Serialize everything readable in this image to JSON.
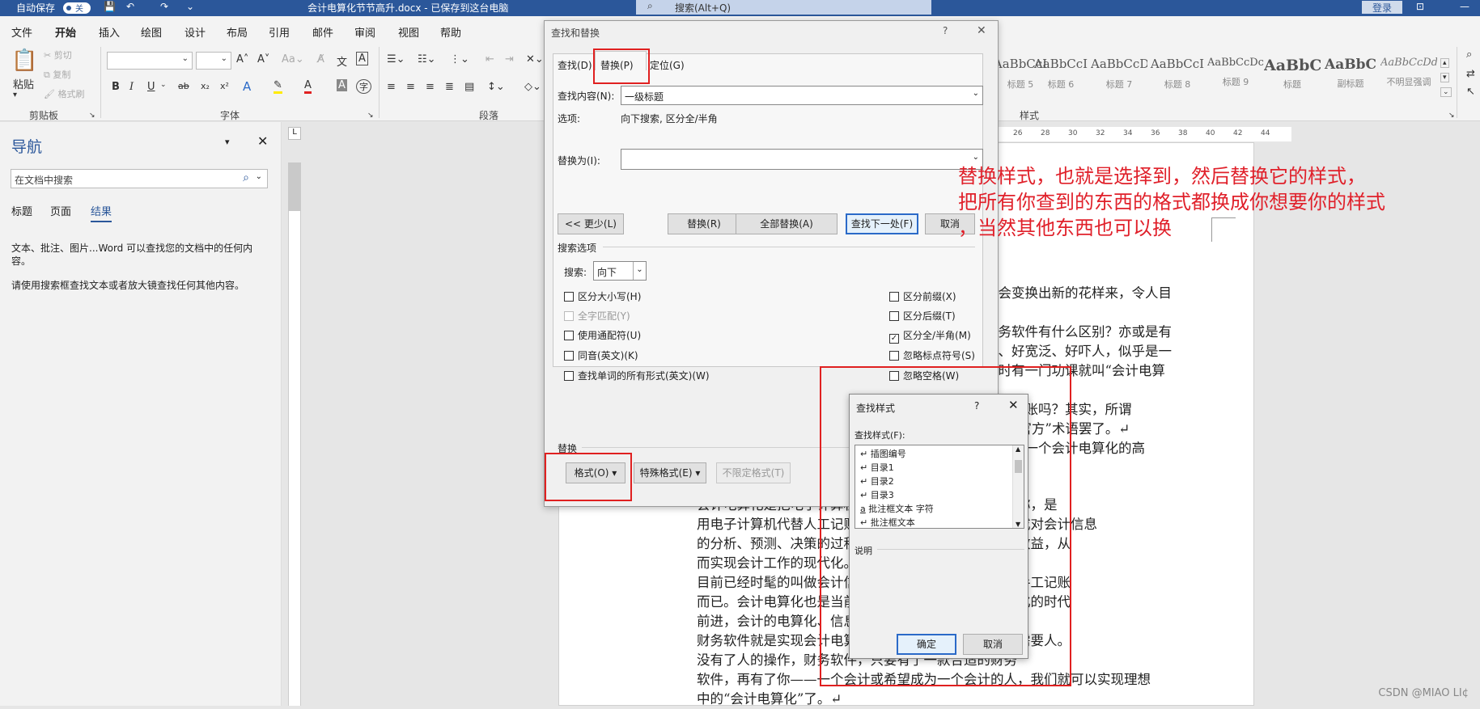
{
  "titlebar": {
    "autosave_label": "自动保存",
    "autosave_state": "关",
    "doc_title": "会计电算化节节高升.docx - 已保存到这台电脑",
    "search_placeholder": "搜索(Alt+Q)",
    "login_label": "登录"
  },
  "menu": [
    "文件",
    "开始",
    "插入",
    "绘图",
    "设计",
    "布局",
    "引用",
    "邮件",
    "审阅",
    "视图",
    "帮助"
  ],
  "menu_active": "开始",
  "ribbon": {
    "clipboard": {
      "paste": "粘贴",
      "cut": "剪切",
      "copy": "复制",
      "painter": "格式刷",
      "group": "剪贴板"
    },
    "font_group": "字体",
    "paragraph_group": "段落",
    "styles_group": "样式",
    "styles": [
      {
        "preview": "AaBbCcI",
        "name": "标题 5"
      },
      {
        "preview": "AaBbCcI",
        "name": "标题 6"
      },
      {
        "preview": "AaBbCcD",
        "name": "标题 7"
      },
      {
        "preview": "AaBbCcI",
        "name": "标题 8"
      },
      {
        "preview": "AaBbCcDc",
        "name": "标题 9"
      },
      {
        "preview": "AaBbC",
        "name": "标题"
      },
      {
        "preview": "AaBbC",
        "name": "副标题"
      },
      {
        "preview": "AaBbCcDd",
        "name": "不明显强调"
      }
    ]
  },
  "nav": {
    "title": "导航",
    "search_placeholder": "在文档中搜索",
    "tabs": [
      "标题",
      "页面",
      "结果"
    ],
    "active_tab": "结果",
    "msg1": "文本、批注、图片...Word 可以查找您的文档中的任何内容。",
    "msg2": "请使用搜索框查找文本或者放大镜查找任何其他内容。"
  },
  "ruler_ticks": [
    "26",
    "28",
    "30",
    "32",
    "34",
    "36",
    "38",
    "40",
    "42",
    "44"
  ],
  "find_replace": {
    "title": "查找和替换",
    "help": "?",
    "tabs": [
      "查找(D)",
      "替换(P)",
      "定位(G)"
    ],
    "active_tab": "替换(P)",
    "find_label": "查找内容(N):",
    "find_value": "一级标题",
    "options_label": "选项:",
    "options_value": "向下搜索, 区分全/半角",
    "replace_label": "替换为(I):",
    "replace_value": "",
    "buttons": {
      "less": "<< 更少(L)",
      "replace": "替换(R)",
      "replace_all": "全部替换(A)",
      "find_next": "查找下一处(F)",
      "cancel": "取消"
    },
    "search_options_label": "搜索选项",
    "search_label": "搜索:",
    "search_value": "向下",
    "left_options": [
      {
        "label": "区分大小写(H)",
        "checked": false,
        "disabled": false
      },
      {
        "label": "全字匹配(Y)",
        "checked": false,
        "disabled": true
      },
      {
        "label": "使用通配符(U)",
        "checked": false,
        "disabled": false
      },
      {
        "label": "同音(英文)(K)",
        "checked": false,
        "disabled": false
      },
      {
        "label": "查找单词的所有形式(英文)(W)",
        "checked": false,
        "disabled": false
      }
    ],
    "right_options": [
      {
        "label": "区分前缀(X)",
        "checked": false
      },
      {
        "label": "区分后缀(T)",
        "checked": false
      },
      {
        "label": "区分全/半角(M)",
        "checked": true
      },
      {
        "label": "忽略标点符号(S)",
        "checked": false
      },
      {
        "label": "忽略空格(W)",
        "checked": false
      }
    ],
    "replace_section": "替换",
    "format_btn": "格式(O) ▾",
    "special_btn": "特殊格式(E) ▾",
    "noformat_btn": "不限定格式(T)"
  },
  "find_style": {
    "title": "查找样式",
    "help": "?",
    "label": "查找样式(F):",
    "items": [
      "插图编号",
      "目录1",
      "目录2",
      "目录3",
      "批注框文本 字符",
      "批注框文本"
    ],
    "item_icons": [
      "↵",
      "↵",
      "↵",
      "↵",
      "a",
      "↵"
    ],
    "desc_label": "说明",
    "ok": "确定",
    "cancel": "取消"
  },
  "doc_lines": [
    "就会变换出新的花样来，令人目",
    "财务软件有什么区别？亦或是有",
    "大、好宽泛、好吓人，似乎是一",
    "正时有一门功课就叫“会计电算",
    "电脑记账吗？其实，所谓",
    "家的“官方”术语罢了。↵",
    "望成为一个会计电算化的高"
  ],
  "doc_body": [
    "会计电算化是把电子计算机技术应用到会计工作中的简称，是",
    "用电子计算机代替人工记账、算账、报账，代替人脑完成对会计信息",
    "的分析、预测、决策的过程，提高经营管理水平和经济效益，从",
    "而实现会计工作的现代化。",
    "目前已经时髦的叫做会计信息化，就是用财务软件代替手工记账",
    "而已。会计电算化也是当前的一种趋势，随着全面信息化的时代",
    "前进，会计的电算化、信息化。",
    "财务软件就是实现会计电算化的工具，当然除此之外还需要人。",
    "没有了人的操作，财务软件，只要有了一款合适的财务",
    "软件，再有了你——一个会计或希望成为一个会计的人，我们就可以实现理想",
    "中的“会计电算化”了。↵"
  ],
  "annotation": [
    "替换样式，也就是选择到，然后替换它的样式，",
    "把所有你查到的东西的格式都换成你想要你的样式",
    "，当然其他东西也可以换"
  ],
  "watermark": "CSDN @MIAO    LI¢"
}
